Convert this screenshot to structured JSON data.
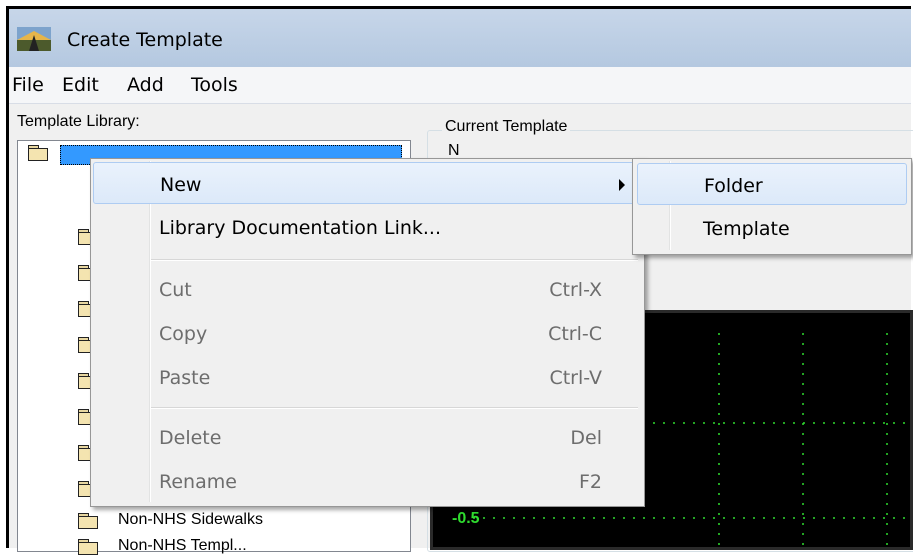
{
  "window": {
    "title": "Create Template"
  },
  "menubar": {
    "items": [
      "File",
      "Edit",
      "Add",
      "Tools"
    ]
  },
  "library": {
    "label": "Template Library:",
    "visible_items": [
      "Non-NHS Sidewalks",
      "Non-NHS Templ..."
    ]
  },
  "current_template": {
    "group_label": "Current Template",
    "name_label": "N"
  },
  "canvas": {
    "axis_value": "-0.5"
  },
  "context_menu": {
    "items": [
      {
        "label": "New",
        "shortcut": "",
        "enabled": true,
        "has_submenu": true
      },
      {
        "label": "Library Documentation Link...",
        "shortcut": "",
        "enabled": true
      },
      {
        "label": "Cut",
        "shortcut": "Ctrl-X",
        "enabled": false
      },
      {
        "label": "Copy",
        "shortcut": "Ctrl-C",
        "enabled": false
      },
      {
        "label": "Paste",
        "shortcut": "Ctrl-V",
        "enabled": false
      },
      {
        "label": "Delete",
        "shortcut": "Del",
        "enabled": false
      },
      {
        "label": "Rename",
        "shortcut": "F2",
        "enabled": false
      }
    ]
  },
  "submenu": {
    "items": [
      "Folder",
      "Template"
    ],
    "highlighted": "Folder"
  }
}
